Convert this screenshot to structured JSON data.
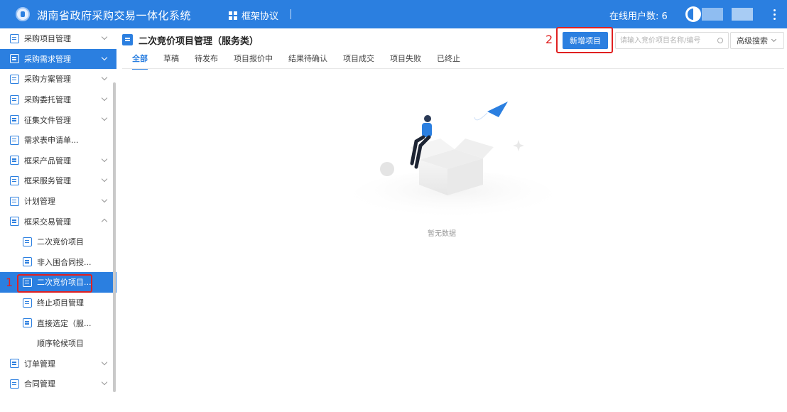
{
  "header": {
    "app_title": "湖南省政府采购交易一体化系统",
    "module_label": "框架协议",
    "online_label": "在线用户数: 6"
  },
  "sidebar": {
    "items": [
      {
        "label": "采购项目管理"
      },
      {
        "label": "采购需求管理"
      },
      {
        "label": "采购方案管理"
      },
      {
        "label": "采购委托管理"
      },
      {
        "label": "征集文件管理"
      },
      {
        "label": "需求表申请单..."
      },
      {
        "label": "框采产品管理"
      },
      {
        "label": "框采服务管理"
      },
      {
        "label": "计划管理"
      },
      {
        "label": "框采交易管理"
      },
      {
        "label": "二次竞价项目"
      },
      {
        "label": "非入围合同授..."
      },
      {
        "label": "二次竞价项目..."
      },
      {
        "label": "终止项目管理"
      },
      {
        "label": "直接选定（服..."
      },
      {
        "label": "顺序轮候项目"
      },
      {
        "label": "订单管理"
      },
      {
        "label": "合同管理"
      }
    ]
  },
  "annotations": {
    "step1": "1",
    "step2": "2"
  },
  "main": {
    "page_title": "二次竞价项目管理（服务类）",
    "tabs": [
      "全部",
      "草稿",
      "待发布",
      "项目报价中",
      "结果待确认",
      "项目成交",
      "项目失败",
      "已终止"
    ],
    "new_button": "新增项目",
    "search_placeholder": "请输入竞价项目名称/编号",
    "advanced_search": "高级搜索",
    "empty_text": "暂无数据"
  },
  "colors": {
    "primary": "#2b7fe0",
    "highlight": "#e02020"
  }
}
